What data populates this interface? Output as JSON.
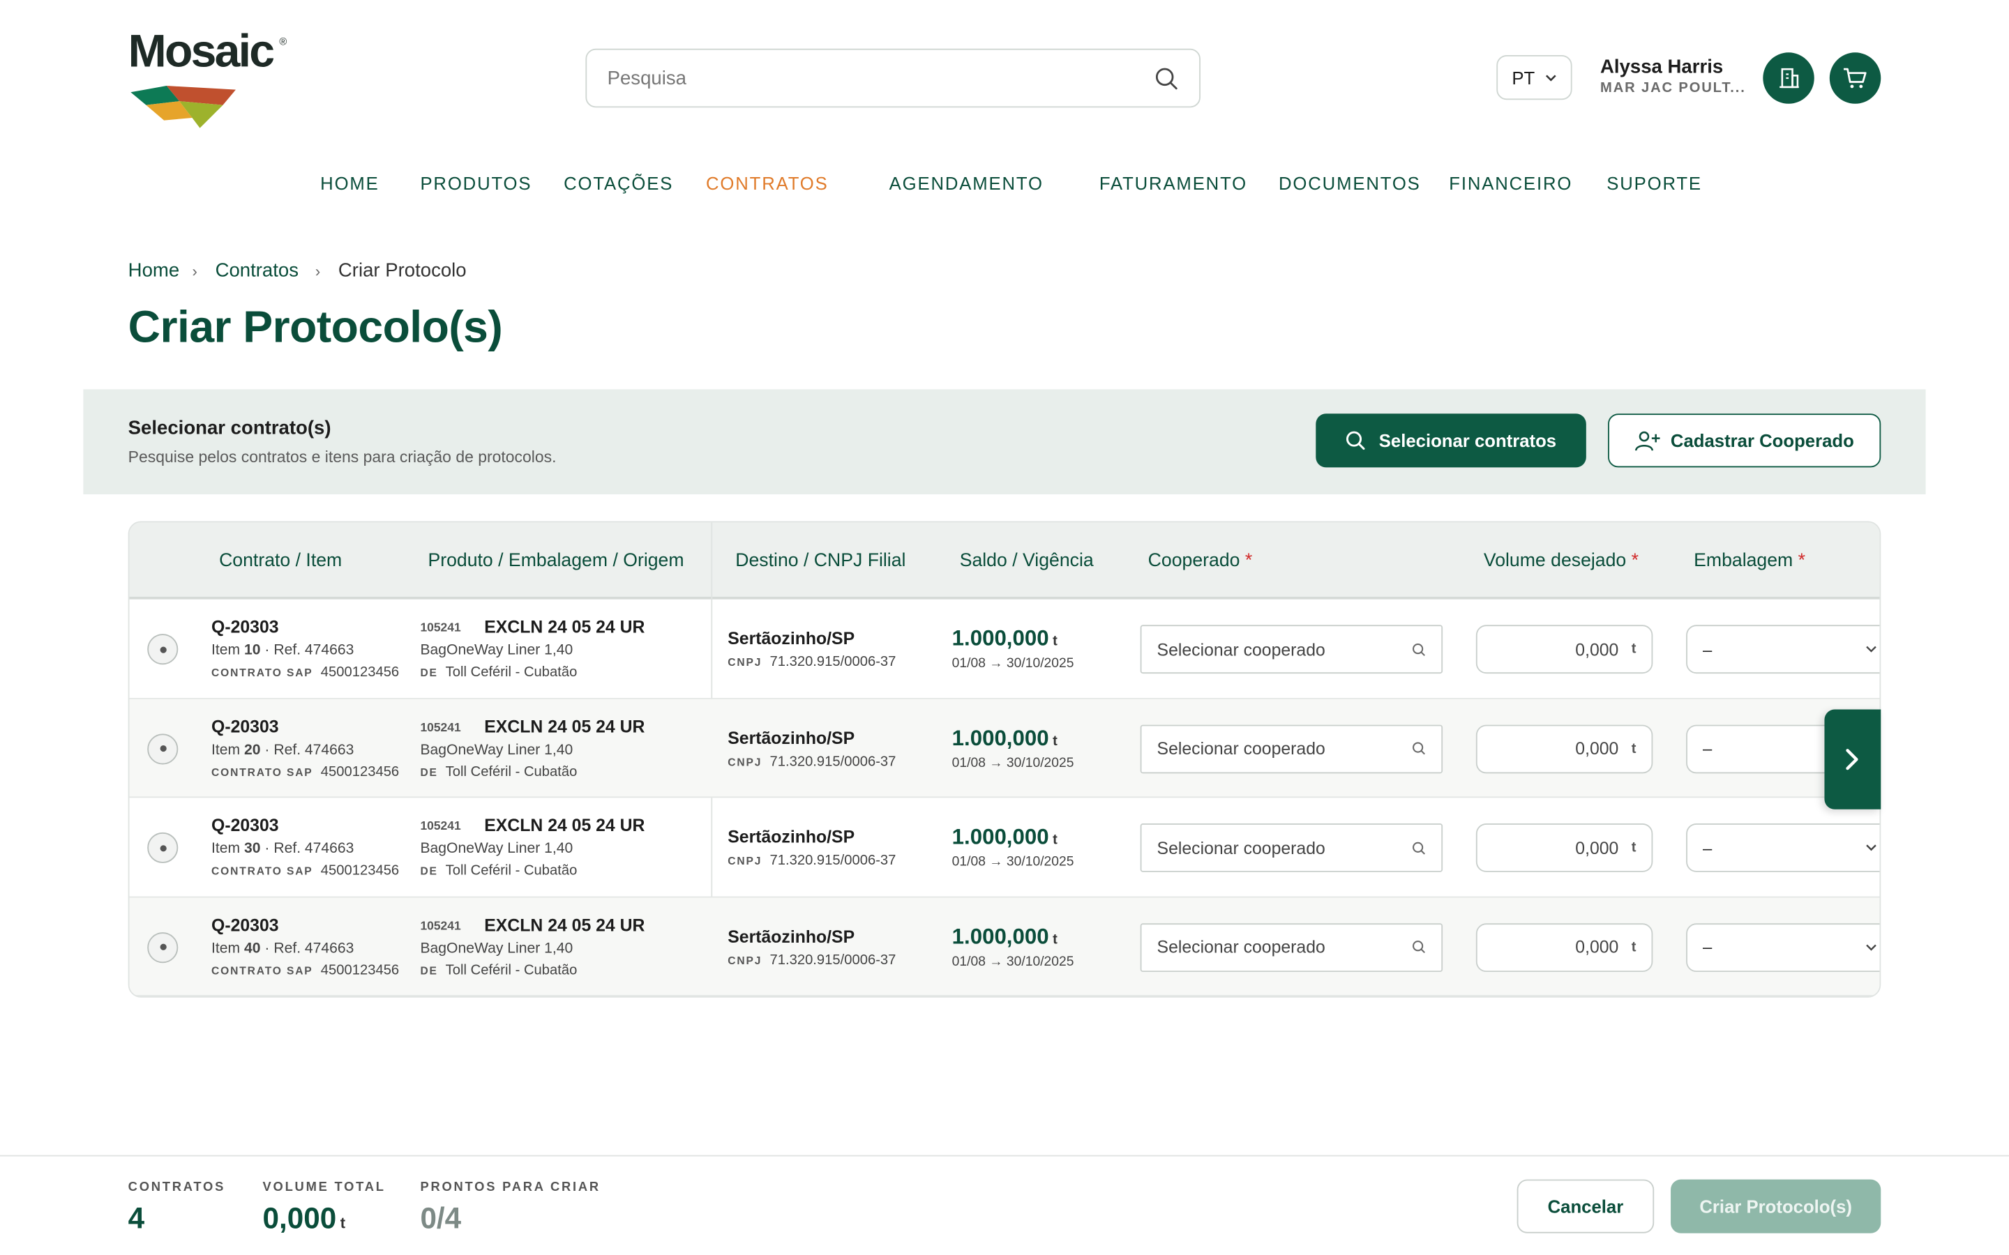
{
  "brand": {
    "name": "Mosaic",
    "registered": "®"
  },
  "search": {
    "placeholder": "Pesquisa"
  },
  "header": {
    "language": "PT",
    "user_name": "Alyssa Harris",
    "user_company": "MAR JAC POULT..."
  },
  "nav": [
    "HOME",
    "PRODUTOS",
    "COTAÇÕES",
    "CONTRATOS",
    "AGENDAMENTO",
    "FATURAMENTO",
    "DOCUMENTOS",
    "FINANCEIRO",
    "SUPORTE"
  ],
  "nav_active": "CONTRATOS",
  "breadcrumb": [
    "Home",
    "Contratos",
    "Criar Protocolo"
  ],
  "page_title": "Criar Protocolo(s)",
  "select_section": {
    "title": "Selecionar contrato(s)",
    "subtitle": "Pesquise pelos contratos e itens para criação de protocolos.",
    "primary_button": "Selecionar contratos",
    "secondary_button": "Cadastrar Cooperado"
  },
  "table": {
    "headers": [
      "Contrato / Item",
      "Produto / Embalagem / Origem",
      "Destino / CNPJ Filial",
      "Saldo / Vigência",
      "Cooperado",
      "Volume desejado",
      "Embalagem"
    ],
    "required_mark": "*",
    "labels": {
      "contrato_sap": "CONTRATO SAP",
      "cnpj": "CNPJ",
      "de": "DE",
      "unit": "t"
    },
    "rows": [
      {
        "contract": "Q-20303",
        "item_prefix": "Item",
        "item": "10",
        "ref": "· Ref. 474663",
        "sap": "4500123456",
        "product_code": "105241",
        "product": "EXCLN 24 05 24 UR",
        "packaging": "BagOneWay Liner 1,40",
        "origin": "Toll Ceféril - Cubatão",
        "destination": "Sertãozinho/SP",
        "cnpj": "71.320.915/0006-37",
        "balance": "1.000,000",
        "validity": "01/08 → 30/10/2025",
        "cooperado_placeholder": "Selecionar cooperado",
        "volume": "0,000",
        "embalagem": "–"
      },
      {
        "contract": "Q-20303",
        "item_prefix": "Item",
        "item": "20",
        "ref": "· Ref. 474663",
        "sap": "4500123456",
        "product_code": "105241",
        "product": "EXCLN 24 05 24 UR",
        "packaging": "BagOneWay Liner 1,40",
        "origin": "Toll Ceféril - Cubatão",
        "destination": "Sertãozinho/SP",
        "cnpj": "71.320.915/0006-37",
        "balance": "1.000,000",
        "validity": "01/08 → 30/10/2025",
        "cooperado_placeholder": "Selecionar cooperado",
        "volume": "0,000",
        "embalagem": "–"
      },
      {
        "contract": "Q-20303",
        "item_prefix": "Item",
        "item": "30",
        "ref": "· Ref. 474663",
        "sap": "4500123456",
        "product_code": "105241",
        "product": "EXCLN 24 05 24 UR",
        "packaging": "BagOneWay Liner 1,40",
        "origin": "Toll Ceféril - Cubatão",
        "destination": "Sertãozinho/SP",
        "cnpj": "71.320.915/0006-37",
        "balance": "1.000,000",
        "validity": "01/08 → 30/10/2025",
        "cooperado_placeholder": "Selecionar cooperado",
        "volume": "0,000",
        "embalagem": "–"
      },
      {
        "contract": "Q-20303",
        "item_prefix": "Item",
        "item": "40",
        "ref": "· Ref. 474663",
        "sap": "4500123456",
        "product_code": "105241",
        "product": "EXCLN 24 05 24 UR",
        "packaging": "BagOneWay Liner 1,40",
        "origin": "Toll Ceféril - Cubatão",
        "destination": "Sertãozinho/SP",
        "cnpj": "71.320.915/0006-37",
        "balance": "1.000,000",
        "validity": "01/08 → 30/10/2025",
        "cooperado_placeholder": "Selecionar cooperado",
        "volume": "0,000",
        "embalagem": "–"
      }
    ]
  },
  "footer": {
    "contracts_label": "CONTRATOS",
    "contracts_value": "4",
    "volume_label": "VOLUME TOTAL",
    "volume_value": "0,000",
    "volume_unit": "t",
    "ready_label": "PRONTOS PARA CRIAR",
    "ready_value": "0/4",
    "cancel_button": "Cancelar",
    "create_button": "Criar Protocolo(s)"
  },
  "colors": {
    "brand_green": "#0d5a43",
    "active_nav": "#e07b2a",
    "required": "#d12a2a",
    "disabled_button": "#8fb8a9"
  },
  "icons": [
    "search-icon",
    "chevron-down-icon",
    "building-icon",
    "cart-icon",
    "user-plus-icon",
    "chevron-right-icon"
  ]
}
